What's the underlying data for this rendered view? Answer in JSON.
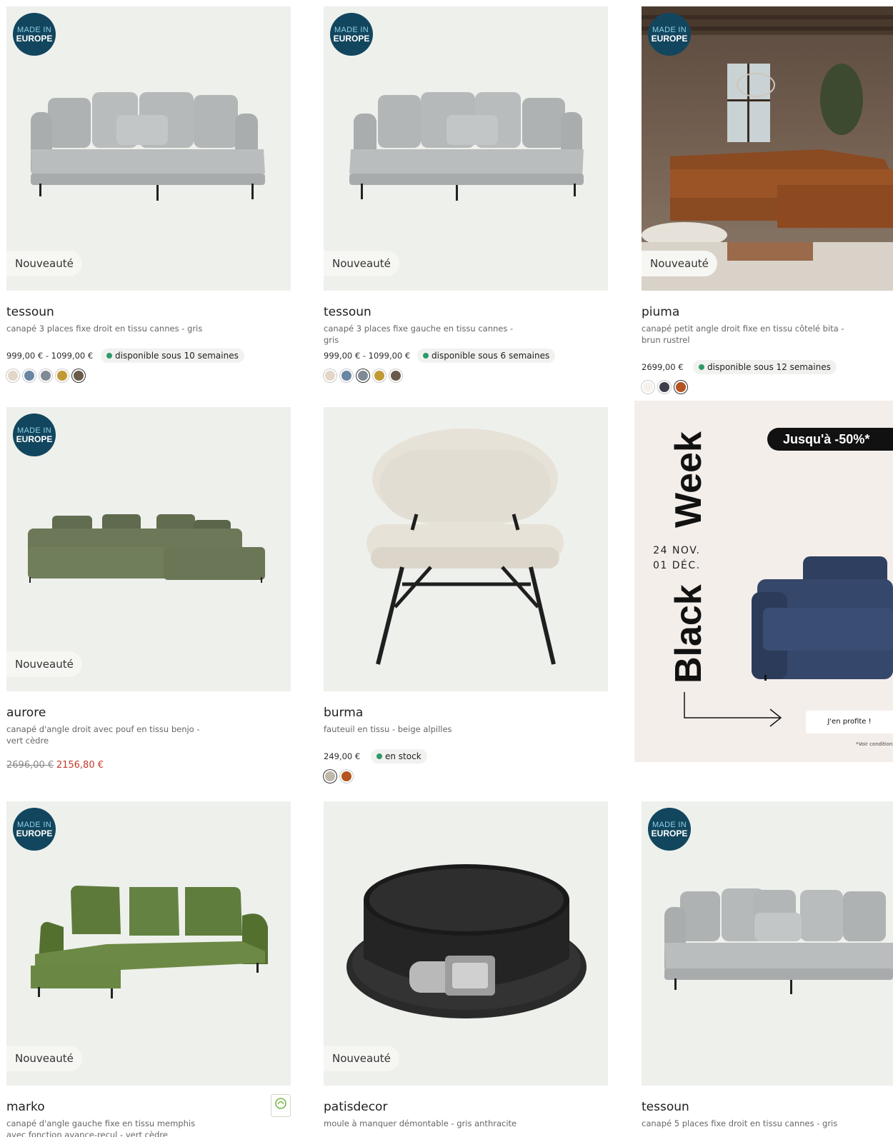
{
  "badges": {
    "made_in_l1": "MADE IN",
    "made_in_l2": "EUROPE",
    "new": "Nouveauté"
  },
  "products": [
    {
      "title": "tessoun",
      "desc": "canapé 3 places fixe droit en tissu cannes - gris",
      "price": "999,00 € - 1099,00 €",
      "availability": "disponible sous 10 semaines",
      "swatches": [
        "#e2d7c6",
        "#6a86a3",
        "#808a94",
        "#c19a35",
        "#6a5a4c"
      ],
      "selected": 4
    },
    {
      "title": "tessoun",
      "desc": "canapé 3 places fixe gauche en tissu cannes - gris",
      "price": "999,00 € - 1099,00 €",
      "availability": "disponible sous 6 semaines",
      "swatches": [
        "#e2d7c6",
        "#6a86a3",
        "#808a94",
        "#c19a35",
        "#6a5a4c"
      ],
      "selected": 2
    },
    {
      "title": "piuma",
      "desc": "canapé petit angle droit fixe en tissu côtelé bita - brun rustrel",
      "price": "2699,00 €",
      "availability": "disponible sous 12 semaines",
      "swatches": [
        "#f4f2ea",
        "#3e3f4b",
        "#b4541f"
      ],
      "selected": 2
    },
    {
      "title": "aurore",
      "desc": "canapé d'angle droit avec pouf en tissu benjo - vert cèdre",
      "old_price": "2696,00 €",
      "sale_price": "2156,80 €"
    },
    {
      "title": "burma",
      "desc": "fauteuil en tissu - beige alpilles",
      "price": "249,00 €",
      "availability": "en stock",
      "swatches": [
        "#bfb8ab",
        "#b4541f"
      ],
      "selected": 0
    },
    {
      "title": "marko",
      "desc": "canapé d'angle gauche fixe en tissu memphis avec fonction avance-recul - vert cèdre"
    },
    {
      "title": "patisdecor",
      "desc": "moule à manquer démontable - gris anthracite"
    },
    {
      "title": "tessoun",
      "desc": "canapé 5 places fixe droit en tissu cannes - gris"
    }
  ],
  "promo": {
    "discount": "Jusqu'à -50%*",
    "word1": "Black",
    "word2": "Week",
    "date1": "24 NOV.",
    "date2": "01 DÉC.",
    "cta": "J'en profite !",
    "note": "*Voir conditions"
  },
  "colors": {
    "badge_blue": "#12465e",
    "available_green": "#2f9a6b",
    "sale_red": "#c0392b",
    "card_bg": "#eef0ec",
    "promo_bg": "#f4eeeb"
  }
}
